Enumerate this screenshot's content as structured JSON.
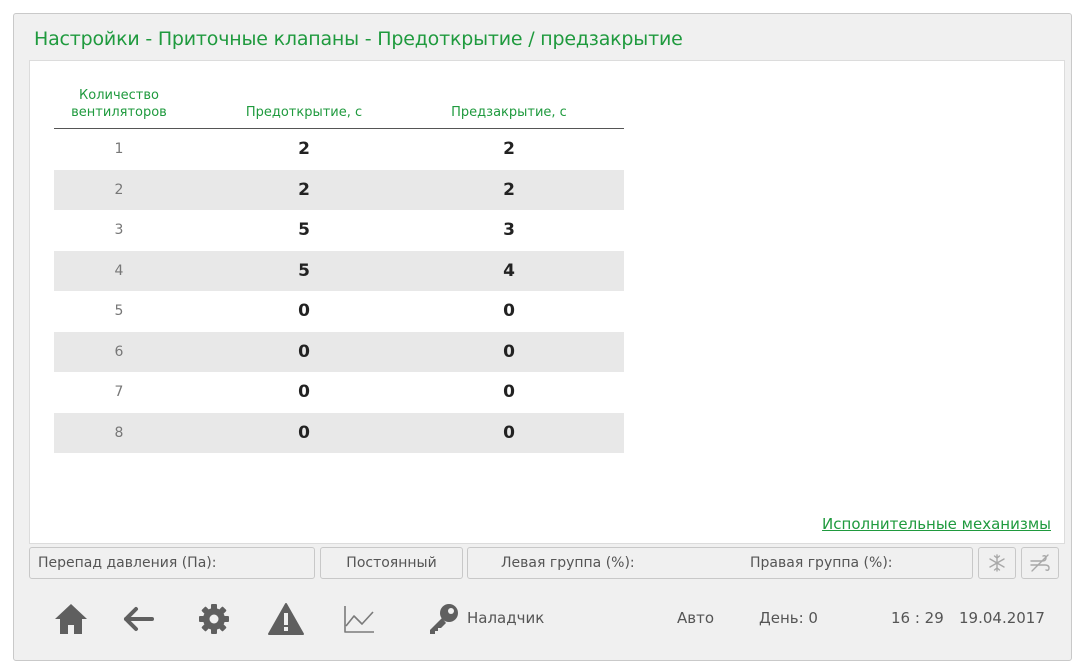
{
  "title": "Настройки - Приточные клапаны - Предоткрытие / предзакрытие",
  "table": {
    "headers": {
      "count_line1": "Количество",
      "count_line2": "вентиляторов",
      "preopen": "Предоткрытие, с",
      "preclose": "Предзакрытие, с"
    },
    "rows": [
      {
        "n": "1",
        "preopen": "2",
        "preclose": "2"
      },
      {
        "n": "2",
        "preopen": "2",
        "preclose": "2"
      },
      {
        "n": "3",
        "preopen": "5",
        "preclose": "3"
      },
      {
        "n": "4",
        "preopen": "5",
        "preclose": "4"
      },
      {
        "n": "5",
        "preopen": "0",
        "preclose": "0"
      },
      {
        "n": "6",
        "preopen": "0",
        "preclose": "0"
      },
      {
        "n": "7",
        "preopen": "0",
        "preclose": "0"
      },
      {
        "n": "8",
        "preopen": "0",
        "preclose": "0"
      }
    ]
  },
  "link_label": "Исполнительные механизмы",
  "status": {
    "pressure": "Перепад давления (Па):",
    "mode": "Постоянный",
    "left_group": "Левая группа (%):",
    "right_group": "Правая группа (%):",
    "icons": [
      "snowflake-icon",
      "wind-off-icon"
    ]
  },
  "nav": {
    "icons": [
      "home-icon",
      "arrow-left-icon",
      "gear-icon",
      "warning-icon",
      "chart-icon",
      "key-icon"
    ],
    "user": "Наладчик",
    "mode": "Авто",
    "day": "День: 0",
    "time": "16 : 29",
    "date": "19.04.2017"
  },
  "colors": {
    "accent": "#1f9a3e",
    "icon": "#5f5f5f",
    "row_alt": "#e8e8e8"
  }
}
